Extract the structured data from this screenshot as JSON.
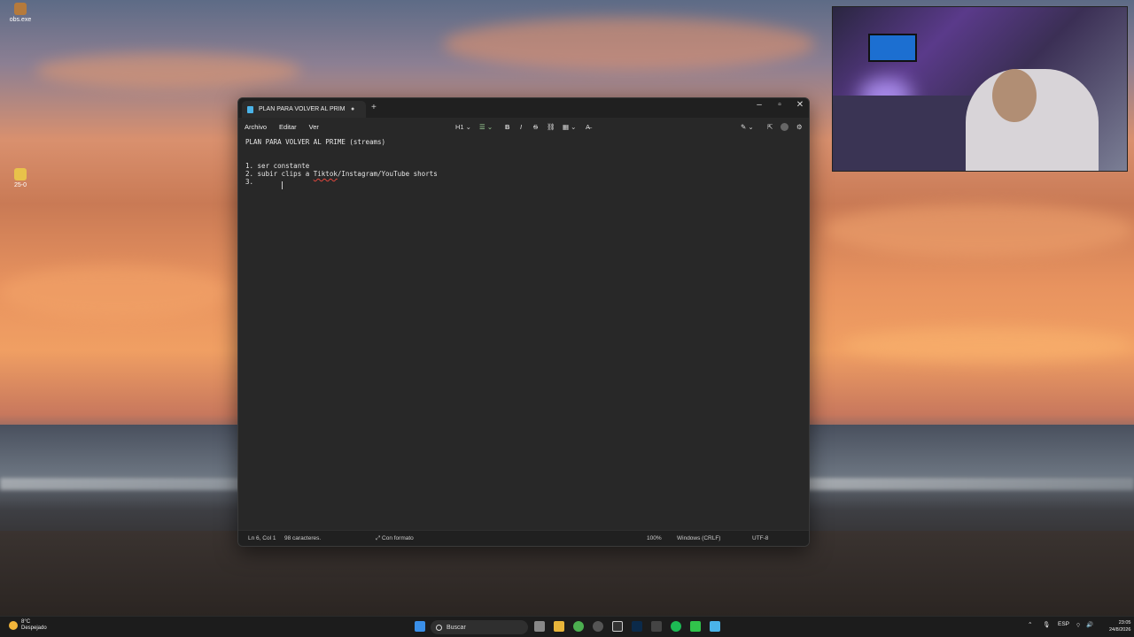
{
  "desktop": {
    "icons": [
      {
        "label": "obs.exe",
        "icon": "obs-icon"
      },
      {
        "label": "25-0",
        "icon": "folder-icon"
      }
    ]
  },
  "window": {
    "tab_title": "PLAN PARA VOLVER AL PRIME (stre",
    "menu": {
      "file": "Archivo",
      "edit": "Editar",
      "view": "Ver"
    },
    "toolbar": {
      "heading": "H1",
      "list": "☰",
      "bold": "B",
      "italic": "I",
      "strike": "S",
      "link": "⛓",
      "table": "▦",
      "clear": "A̶"
    },
    "editor_lines": {
      "title": "PLAN PARA VOLVER AL PRIME (streams)",
      "l1": "1. ser constante",
      "l2_a": "2. subir clips a ",
      "l2_spell": "Tiktok",
      "l2_b": "/Instagram/YouTube shorts",
      "l3": "3. "
    },
    "status": {
      "position": "Ln 6, Col 1",
      "chars": "98 caracteres.",
      "format": "Con formato",
      "zoom": "100%",
      "eol": "Windows (CRLF)",
      "encoding": "UTF-8"
    }
  },
  "taskbar": {
    "weather_temp": "8°C",
    "weather_desc": "Despejado",
    "search_placeholder": "Buscar",
    "lang": "ESP",
    "time": "23:05",
    "date": "24/8/2026"
  }
}
